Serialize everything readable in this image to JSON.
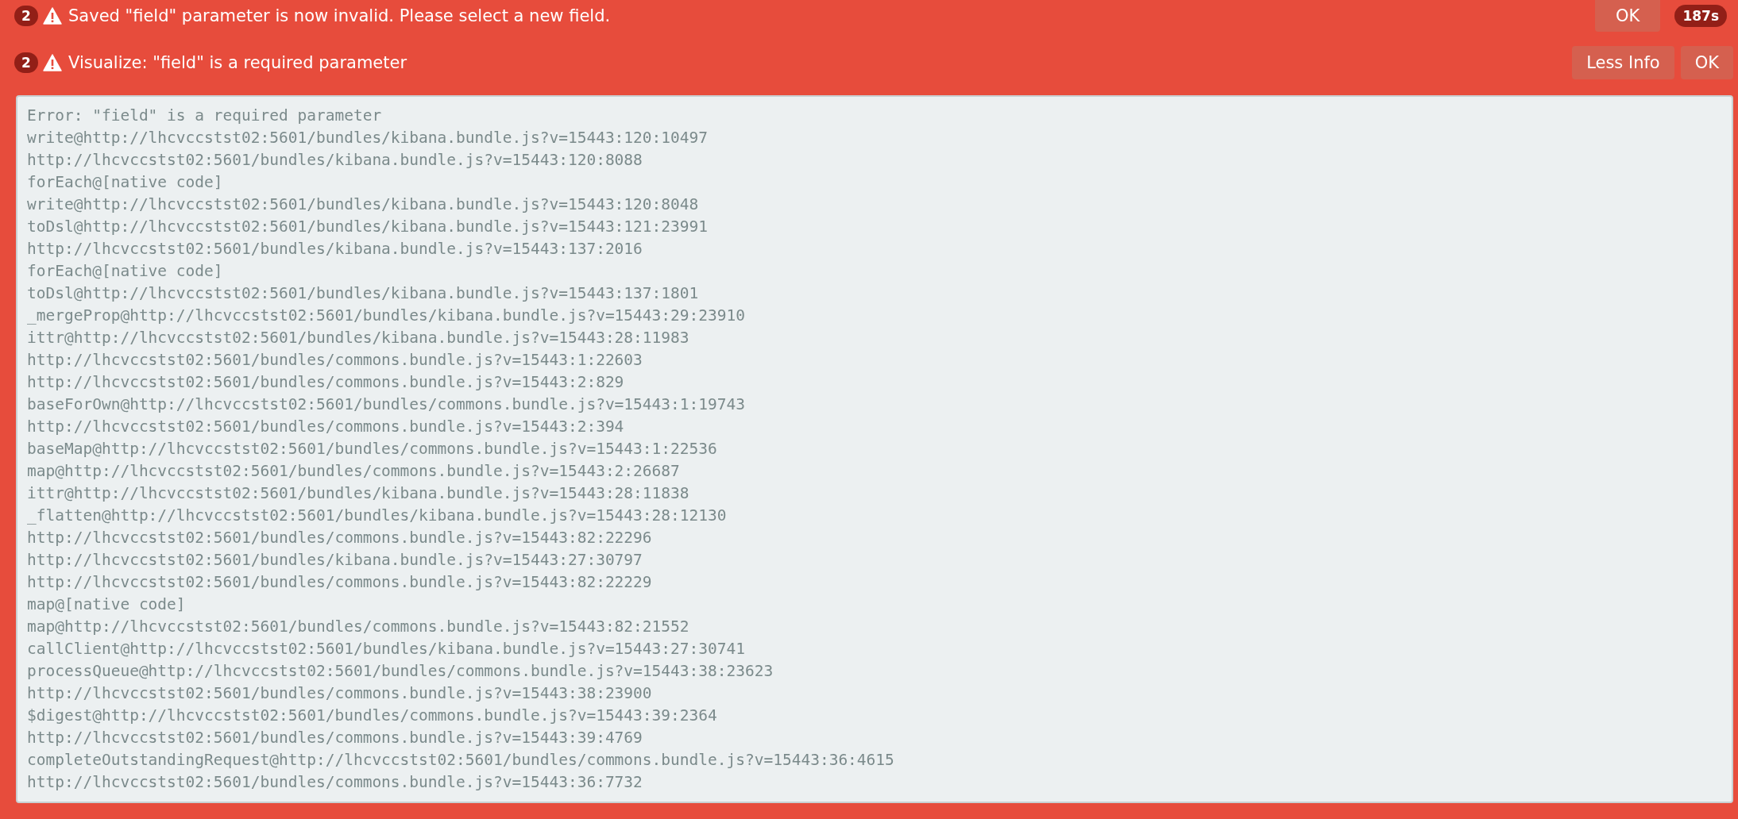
{
  "notifications": [
    {
      "count": "2",
      "message": "Saved \"field\" parameter is now invalid. Please select a new field.",
      "buttons": [
        "OK"
      ],
      "timer": "187s"
    },
    {
      "count": "2",
      "message": "Visualize: \"field\" is a required parameter",
      "buttons": [
        "Less Info",
        "OK"
      ],
      "details": [
        "Error: \"field\" is a required parameter",
        "write@http://lhcvccstst02:5601/bundles/kibana.bundle.js?v=15443:120:10497",
        "http://lhcvccstst02:5601/bundles/kibana.bundle.js?v=15443:120:8088",
        "forEach@[native code]",
        "write@http://lhcvccstst02:5601/bundles/kibana.bundle.js?v=15443:120:8048",
        "toDsl@http://lhcvccstst02:5601/bundles/kibana.bundle.js?v=15443:121:23991",
        "http://lhcvccstst02:5601/bundles/kibana.bundle.js?v=15443:137:2016",
        "forEach@[native code]",
        "toDsl@http://lhcvccstst02:5601/bundles/kibana.bundle.js?v=15443:137:1801",
        "_mergeProp@http://lhcvccstst02:5601/bundles/kibana.bundle.js?v=15443:29:23910",
        "ittr@http://lhcvccstst02:5601/bundles/kibana.bundle.js?v=15443:28:11983",
        "http://lhcvccstst02:5601/bundles/commons.bundle.js?v=15443:1:22603",
        "http://lhcvccstst02:5601/bundles/commons.bundle.js?v=15443:2:829",
        "baseForOwn@http://lhcvccstst02:5601/bundles/commons.bundle.js?v=15443:1:19743",
        "http://lhcvccstst02:5601/bundles/commons.bundle.js?v=15443:2:394",
        "baseMap@http://lhcvccstst02:5601/bundles/commons.bundle.js?v=15443:1:22536",
        "map@http://lhcvccstst02:5601/bundles/commons.bundle.js?v=15443:2:26687",
        "ittr@http://lhcvccstst02:5601/bundles/kibana.bundle.js?v=15443:28:11838",
        "_flatten@http://lhcvccstst02:5601/bundles/kibana.bundle.js?v=15443:28:12130",
        "http://lhcvccstst02:5601/bundles/commons.bundle.js?v=15443:82:22296",
        "http://lhcvccstst02:5601/bundles/kibana.bundle.js?v=15443:27:30797",
        "http://lhcvccstst02:5601/bundles/commons.bundle.js?v=15443:82:22229",
        "map@[native code]",
        "map@http://lhcvccstst02:5601/bundles/commons.bundle.js?v=15443:82:21552",
        "callClient@http://lhcvccstst02:5601/bundles/kibana.bundle.js?v=15443:27:30741",
        "processQueue@http://lhcvccstst02:5601/bundles/commons.bundle.js?v=15443:38:23623",
        "http://lhcvccstst02:5601/bundles/commons.bundle.js?v=15443:38:23900",
        "$digest@http://lhcvccstst02:5601/bundles/commons.bundle.js?v=15443:39:2364",
        "http://lhcvccstst02:5601/bundles/commons.bundle.js?v=15443:39:4769",
        "completeOutstandingRequest@http://lhcvccstst02:5601/bundles/commons.bundle.js?v=15443:36:4615",
        "http://lhcvccstst02:5601/bundles/commons.bundle.js?v=15443:36:7732"
      ]
    }
  ]
}
